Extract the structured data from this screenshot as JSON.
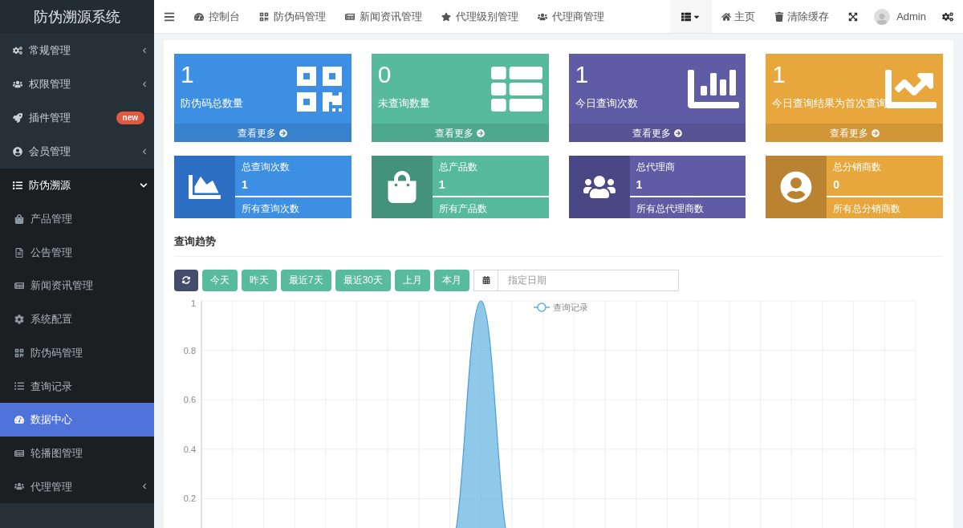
{
  "app_title": "防伪溯源系统",
  "top_nav": [
    {
      "label": "控制台"
    },
    {
      "label": "防伪码管理"
    },
    {
      "label": "新闻资讯管理"
    },
    {
      "label": "代理级别管理"
    },
    {
      "label": "代理商管理"
    }
  ],
  "top_right": [
    {
      "kind": "home",
      "label": "主页"
    },
    {
      "kind": "clear",
      "label": "清除缓存"
    }
  ],
  "user": {
    "name": "Admin"
  },
  "sidebar": {
    "items": [
      {
        "label": "常规管理",
        "expanded": false,
        "selected": false
      },
      {
        "label": "权限管理",
        "expanded": false,
        "selected": false
      },
      {
        "label": "插件管理",
        "badge": "new",
        "selected": false
      },
      {
        "label": "会员管理",
        "expanded": false,
        "selected": false
      },
      {
        "label": "防伪溯源",
        "expanded": true,
        "selected": false,
        "children": [
          {
            "label": "产品管理",
            "selected": false
          },
          {
            "label": "公告管理",
            "selected": false
          },
          {
            "label": "新闻资讯管理",
            "selected": false
          },
          {
            "label": "系统配置",
            "selected": false
          },
          {
            "label": "防伪码管理",
            "selected": false
          },
          {
            "label": "查询记录",
            "selected": false
          },
          {
            "label": "数据中心",
            "selected": true
          },
          {
            "label": "轮播图管理",
            "selected": false
          },
          {
            "label": "代理管理",
            "expanded": false,
            "selected": false
          }
        ]
      }
    ]
  },
  "stat_cards": [
    {
      "value": "1",
      "label": "防伪码总数量",
      "more": "查看更多",
      "color": "#3d8fe4"
    },
    {
      "value": "0",
      "label": "未查询数量",
      "more": "查看更多",
      "color": "#57bb9b"
    },
    {
      "value": "1",
      "label": "今日查询次数",
      "more": "查看更多",
      "color": "#5f5ba4"
    },
    {
      "value": "1",
      "label": "今日查询结果为首次查询",
      "more": "查看更多",
      "color": "#e8a73d"
    }
  ],
  "info_cards": [
    {
      "title": "总查询次数",
      "value": "1",
      "footer": "所有查询次数",
      "color": "#3d8fe4"
    },
    {
      "title": "总产品数",
      "value": "1",
      "footer": "所有产品数",
      "color": "#57bb9b"
    },
    {
      "title": "总代理商",
      "value": "1",
      "footer": "所有总代理商数",
      "color": "#5f5ba4"
    },
    {
      "title": "总分销商数",
      "value": "0",
      "footer": "所有总分销商数",
      "color": "#e8a73d"
    }
  ],
  "trend": {
    "title": "查询趋势",
    "filters": [
      "今天",
      "昨天",
      "最近7天",
      "最近30天",
      "上月",
      "本月"
    ],
    "date_field": {
      "placeholder": "指定日期"
    },
    "chart_data": {
      "type": "area",
      "grid": true,
      "ylim": [
        0,
        1
      ],
      "yticks": [
        0.2,
        0.4,
        0.6,
        0.8,
        {
          "value": 1,
          "label": "1"
        }
      ],
      "series": [
        {
          "name": "查询记录",
          "color": "#5fb0e0",
          "values": [
            0,
            0,
            0,
            0,
            0,
            0,
            0,
            0,
            0,
            1,
            0,
            0,
            0,
            0,
            0,
            0,
            0,
            0,
            0,
            0,
            0,
            0,
            0,
            0
          ]
        }
      ]
    }
  }
}
